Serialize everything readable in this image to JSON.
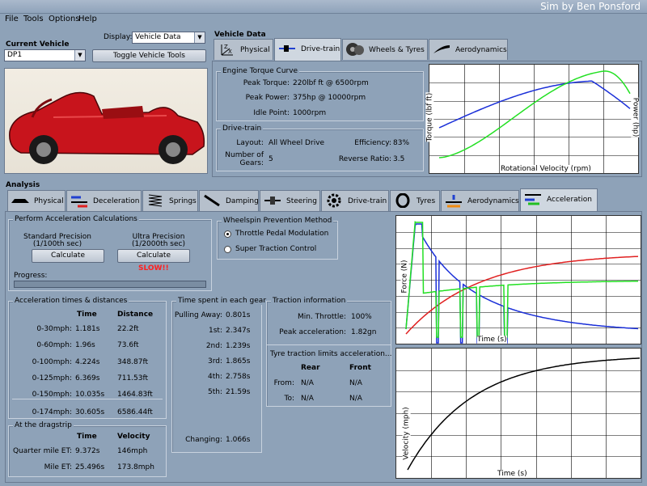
{
  "window": {
    "title": "Sim by Ben Ponsford"
  },
  "menu": [
    "File",
    "Tools",
    "Options",
    "Help"
  ],
  "vehicle": {
    "current_label": "Current Vehicle",
    "current_value": "DP1",
    "display_label": "Display:",
    "display_value": "Vehicle Data",
    "toggle_label": "Toggle Vehicle Tools"
  },
  "vehicle_data": {
    "heading": "Vehicle Data",
    "tabs": [
      "Physical",
      "Drive-train",
      "Wheels & Tyres",
      "Aerodynamics"
    ],
    "engine": {
      "title": "Engine Torque Curve",
      "peak_torque_label": "Peak Torque:",
      "peak_torque_value": "220lbf ft @ 6500rpm",
      "peak_power_label": "Peak Power:",
      "peak_power_value": "375hp @ 10000rpm",
      "idle_label": "Idle Point:",
      "idle_value": "1000rpm"
    },
    "drivetrain": {
      "title": "Drive-train",
      "layout_label": "Layout:",
      "layout_value": "All Wheel Drive",
      "efficiency_label": "Efficiency:",
      "efficiency_value": "83%",
      "gears_label_1": "Number of",
      "gears_label_2": "Gears:",
      "gears_value": "5",
      "reverse_label": "Reverse Ratio:",
      "reverse_value": "3.5"
    },
    "torque_graph": {
      "xlabel": "Rotational Velocity (rpm)",
      "ylabel_left": "Torque (lbf ft)",
      "ylabel_right": "Power (hp)"
    }
  },
  "analysis": {
    "heading": "Analysis",
    "tabs": [
      "Physical",
      "Deceleration",
      "Springs",
      "Damping",
      "Steering",
      "Drive-train",
      "Tyres",
      "Aerodynamics",
      "Acceleration"
    ],
    "calc": {
      "title": "Perform Acceleration Calculations",
      "std_label_1": "Standard Precision",
      "std_label_2": "(1/100th sec)",
      "ultra_label_1": "Ultra Precision",
      "ultra_label_2": "(1/2000th sec)",
      "calc_button": "Calculate",
      "slow_warning": "SLOW!!",
      "progress_label": "Progress:",
      "progress_fraction": 0
    },
    "wheelspin": {
      "title": "Wheelspin Prevention Method",
      "options": [
        "Throttle Pedal Modulation",
        "Super Traction Control"
      ],
      "selected": 0
    },
    "accel_table": {
      "title": "Acceleration times & distances",
      "header_time": "Time",
      "header_distance": "Distance",
      "rows": [
        {
          "label": "0-30mph:",
          "time": "1.181s",
          "dist": "22.2ft"
        },
        {
          "label": "0-60mph:",
          "time": "1.96s",
          "dist": "73.6ft"
        },
        {
          "label": "0-100mph:",
          "time": "4.224s",
          "dist": "348.87ft"
        },
        {
          "label": "0-125mph:",
          "time": "6.369s",
          "dist": "711.53ft"
        },
        {
          "label": "0-150mph:",
          "time": "10.035s",
          "dist": "1464.83ft"
        },
        {
          "label": "0-174mph:",
          "time": "30.605s",
          "dist": "6586.44ft"
        }
      ]
    },
    "dragstrip": {
      "title": "At the dragstrip",
      "header_time": "Time",
      "header_velocity": "Velocity",
      "rows": [
        {
          "label": "Quarter mile ET:",
          "time": "9.372s",
          "vel": "146mph"
        },
        {
          "label": "Mile ET:",
          "time": "25.496s",
          "vel": "173.8mph"
        }
      ]
    },
    "gear_time": {
      "title": "Time spent in each gear",
      "rows": [
        {
          "label": "Pulling Away:",
          "value": "0.801s"
        },
        {
          "label": "1st:",
          "value": "2.347s"
        },
        {
          "label": "2nd:",
          "value": "1.239s"
        },
        {
          "label": "3rd:",
          "value": "1.865s"
        },
        {
          "label": "4th:",
          "value": "2.758s"
        },
        {
          "label": "5th:",
          "value": "21.59s"
        }
      ],
      "changing_label": "Changing:",
      "changing_value": "1.066s"
    },
    "traction": {
      "title": "Traction information",
      "min_throttle_label": "Min. Throttle:",
      "min_throttle_value": "100%",
      "peak_accel_label": "Peak acceleration:",
      "peak_accel_value": "1.82gn"
    },
    "tyre_limits": {
      "title": "Tyre traction limits acceleration...",
      "header_rear": "Rear",
      "header_front": "Front",
      "from_label": "From:",
      "to_label": "To:",
      "from_rear": "N/A",
      "from_front": "N/A",
      "to_rear": "N/A",
      "to_front": "N/A"
    },
    "force_graph": {
      "xlabel": "Time (s)",
      "ylabel": "Force (N)"
    },
    "velocity_graph": {
      "xlabel": "Time (s)",
      "ylabel": "Velocity (mph)"
    }
  },
  "colors": {
    "torque": "#1a2fd8",
    "power": "#22e022",
    "traction_force": "#22e022",
    "drive_force": "#1a2fd8",
    "drag_force": "#e02020",
    "velocity": "#000000",
    "slow": "#ff2020"
  }
}
